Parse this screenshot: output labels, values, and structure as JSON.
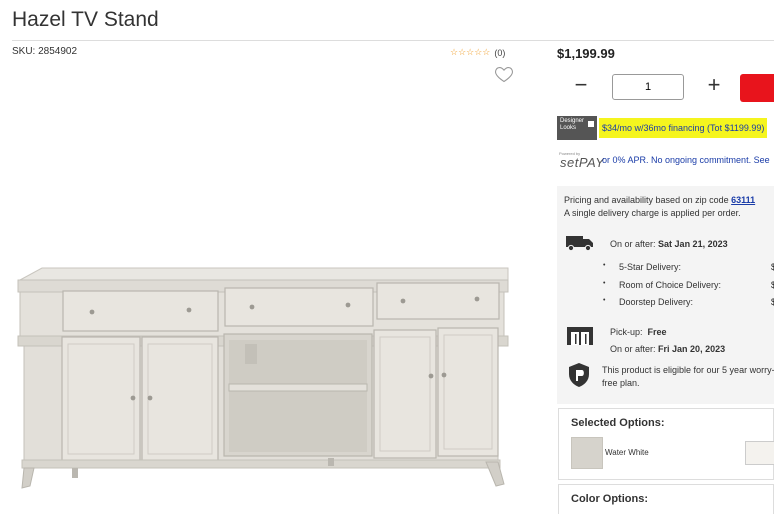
{
  "product": {
    "title": "Hazel TV Stand",
    "sku": "SKU: 2854902",
    "rating_stars": "☆☆☆☆☆",
    "review_count": "(0)"
  },
  "purchase": {
    "price": "$1,199.99",
    "minus": "−",
    "quantity": "1",
    "plus": "+"
  },
  "financing": {
    "logo_text": "Designer Looks",
    "offer": "$34/mo w/36mo financing (Tot $1199.99)"
  },
  "setpay": {
    "small_text": "Powered by",
    "logo": "setPAY",
    "text": "or 0% APR. No ongoing commitment. See"
  },
  "availability": {
    "zip_prefix": "Pricing and availability based on zip code ",
    "zip": "63111",
    "delivery_note": "A single delivery charge is applied per order.",
    "delivery_on_after": "On or after:",
    "delivery_date": "Sat Jan 21, 2023",
    "delivery_options": [
      "5-Star Delivery:",
      "Room of Choice Delivery:",
      "Doorstep Delivery:"
    ],
    "delivery_prices": [
      "$",
      "$",
      "$"
    ],
    "pickup_label": "Pick-up:",
    "pickup_price": "Free",
    "pickup_on_after": "On or after:",
    "pickup_date": "Fri Jan 20, 2023",
    "warranty": "This product is eligible for our 5 year worry-free plan."
  },
  "options": {
    "selected_title": "Selected Options:",
    "selected_value": "Water White",
    "color_title": "Color Options:"
  },
  "colors": {
    "accent": "#e8141c",
    "highlight": "#f5f51e",
    "link": "#1a3ca8"
  }
}
